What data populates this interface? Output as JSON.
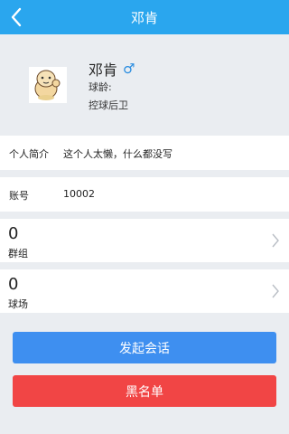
{
  "header": {
    "title": "邓肯"
  },
  "profile": {
    "name": "邓肯",
    "gender_symbol": "♂",
    "age_label": "球龄:",
    "position": "控球后卫"
  },
  "intro": {
    "label": "个人简介",
    "value": "这个人太懒，什么都没写"
  },
  "account": {
    "label": "账号",
    "value": "10002"
  },
  "groups": {
    "count": "0",
    "label": "群组"
  },
  "courts": {
    "count": "0",
    "label": "球场"
  },
  "buttons": {
    "start_chat": "发起会话",
    "blacklist": "黑名单"
  },
  "colors": {
    "navbar": "#2aa6ee",
    "chat_button": "#3e8ff0",
    "blacklist_button": "#f14545",
    "gender": "#2a8de0"
  }
}
